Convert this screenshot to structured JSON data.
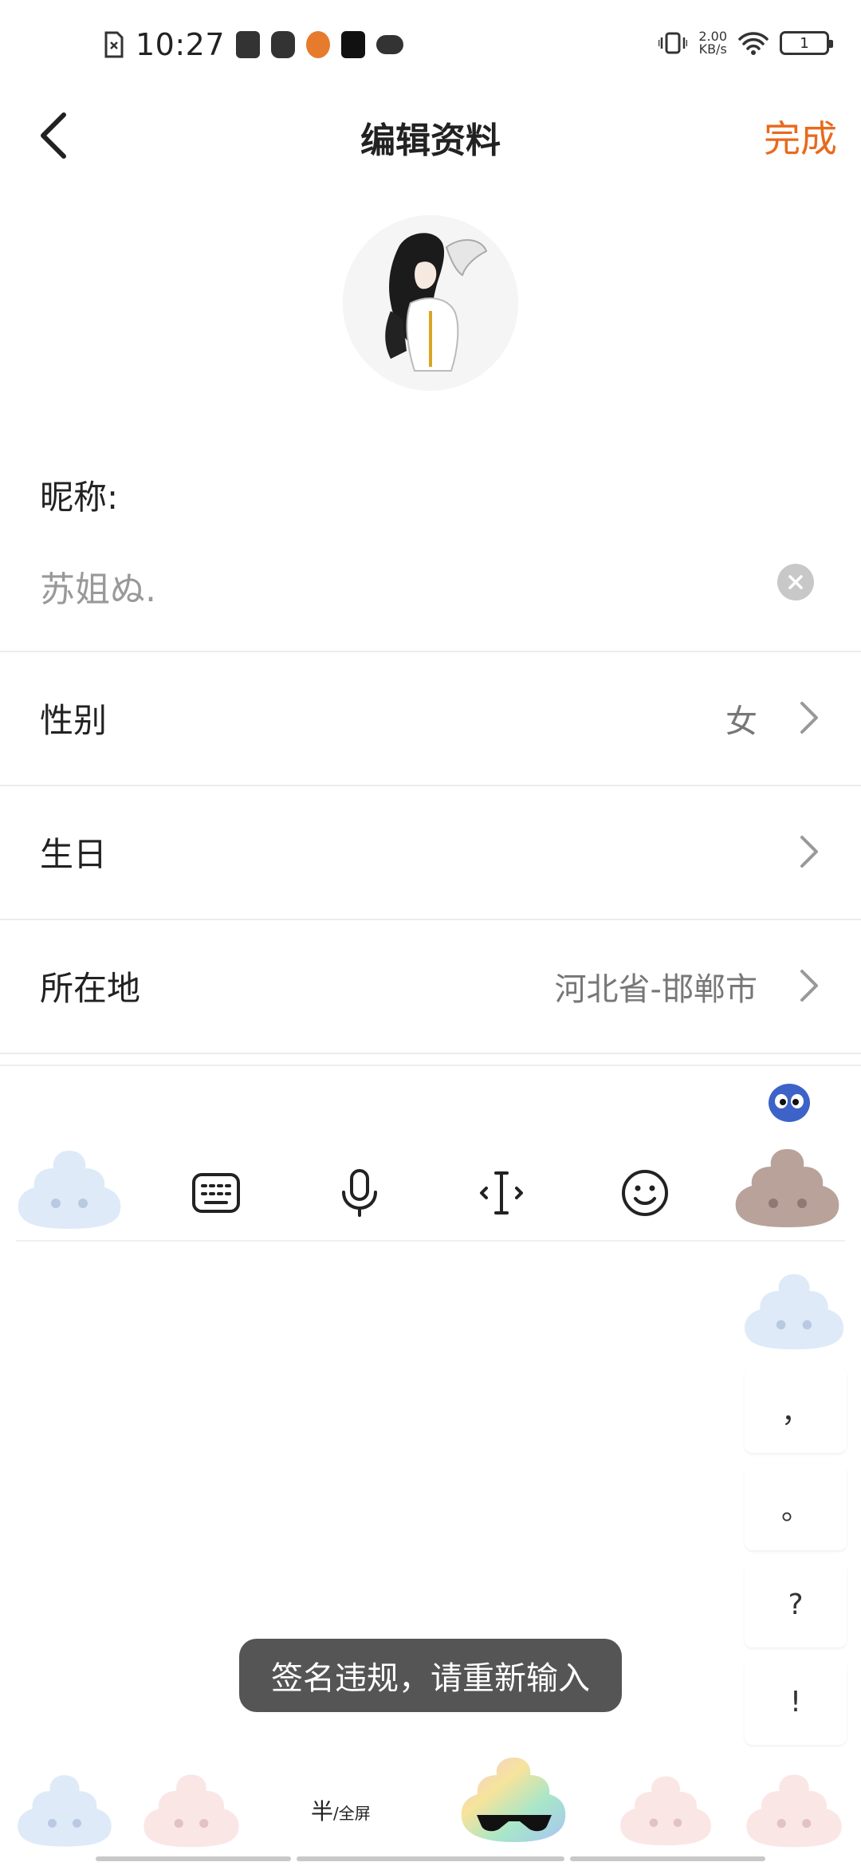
{
  "status_bar": {
    "time": "10:27",
    "net_speed_value": "2.00",
    "net_speed_unit": "KB/s",
    "battery": "1"
  },
  "header": {
    "title": "编辑资料",
    "done_label": "完成"
  },
  "profile": {
    "nickname_label": "昵称:",
    "nickname_value": "苏姐ぬ.",
    "rows": [
      {
        "label": "性别",
        "value": "女"
      },
      {
        "label": "生日",
        "value": ""
      },
      {
        "label": "所在地",
        "value": "河北省-邯郸市"
      }
    ]
  },
  "keyboard": {
    "punctuation": [
      "，",
      "。",
      "?",
      "!"
    ],
    "half_label": "半",
    "full_label": "/全屏",
    "toolbar_icons": [
      "keyboard-icon",
      "microphone-icon",
      "cursor-icon",
      "emoji-icon"
    ]
  },
  "toast": {
    "message": "签名违规，请重新输入"
  },
  "colors": {
    "accent": "#e86a1c",
    "toast_bg": "#555555"
  }
}
